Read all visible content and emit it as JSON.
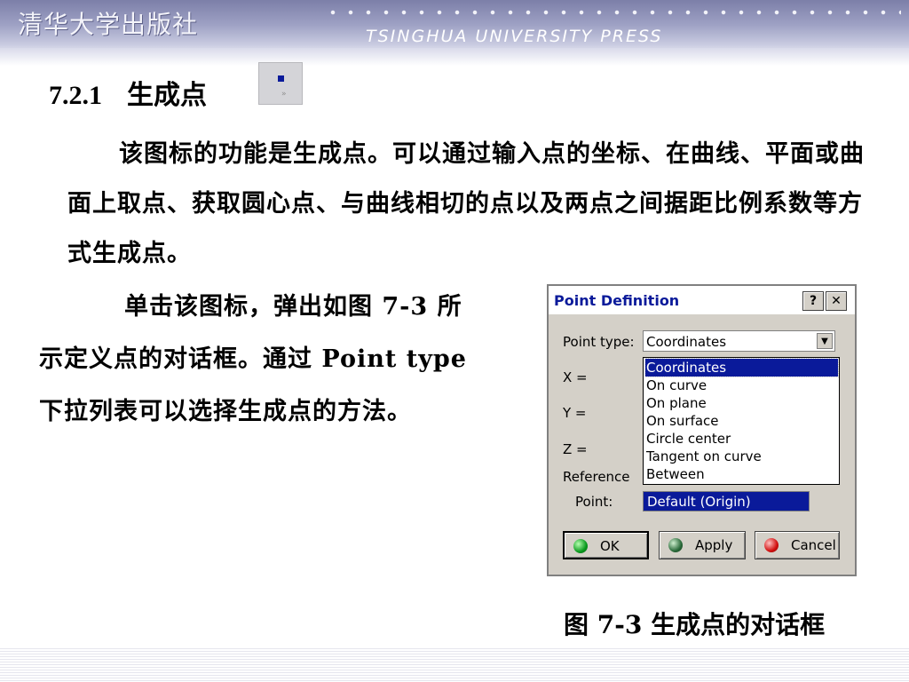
{
  "banner": {
    "publisher_cn": "清华大学出版社",
    "publisher_en": "TSINGHUA UNIVERSITY PRESS"
  },
  "section": {
    "number": "7.2.1",
    "title": "生成点",
    "icon": "point-icon"
  },
  "paragraph1": "该图标的功能是生成点。可以通过输入点的坐标、在曲线、平面或曲面上取点、获取圆心点、与曲线相切的点以及两点之间据距比例系数等方式生成点。",
  "paragraph2": {
    "line1": "单击该图标，弹出如图 7-3 所",
    "line2": "示定义点的对话框。通过 Point type",
    "line3": "下拉列表可以选择生成点的方法。"
  },
  "dialog": {
    "title": "Point Definition",
    "help_label": "?",
    "close_label": "✕",
    "point_type_label": "Point type:",
    "point_type_value": "Coordinates",
    "x_label": "X =",
    "y_label": "Y =",
    "z_label": "Z =",
    "reference_label": "Reference",
    "point_label": "Point:",
    "point_value": "Default (Origin)",
    "options": [
      "Coordinates",
      "On curve",
      "On plane",
      "On surface",
      "Circle center",
      "Tangent on curve",
      "Between"
    ],
    "selected_option": "Coordinates",
    "ok_label": "OK",
    "apply_label": "Apply",
    "cancel_label": "Cancel"
  },
  "caption": "图 7-3 生成点的对话框",
  "colors": {
    "selection": "#0a1a9a",
    "dialog_bg": "#d4d0c8",
    "banner": "#9ea1c4"
  }
}
